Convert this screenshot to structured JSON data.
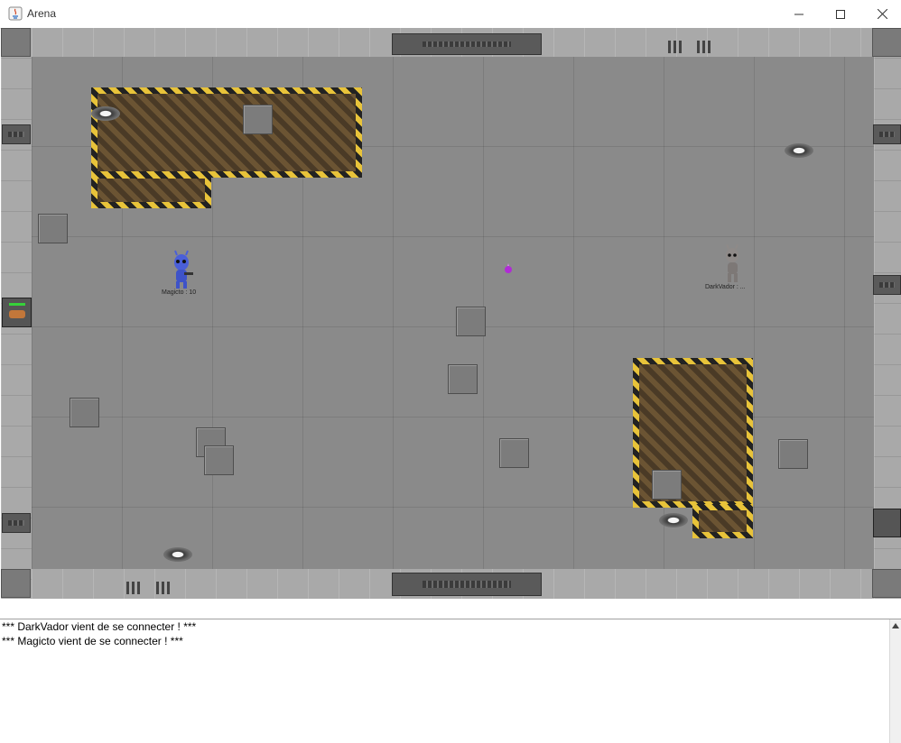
{
  "window": {
    "title": "Arena",
    "minimize_icon": "minimize-icon",
    "maximize_icon": "maximize-icon",
    "close_icon": "close-icon"
  },
  "players": [
    {
      "name_label": "Magicto : 10",
      "color": "#4a5fd8"
    },
    {
      "name_label": "DarkVador : ...",
      "color": "#8f8a88"
    }
  ],
  "colors": {
    "hazard_stripe": "#e8c33a",
    "floor": "#8a8a8a",
    "orb": "#b02bd6"
  },
  "chat": {
    "lines": [
      "*** DarkVador vient de se connecter ! ***",
      "*** Magicto vient de se connecter ! ***"
    ]
  }
}
